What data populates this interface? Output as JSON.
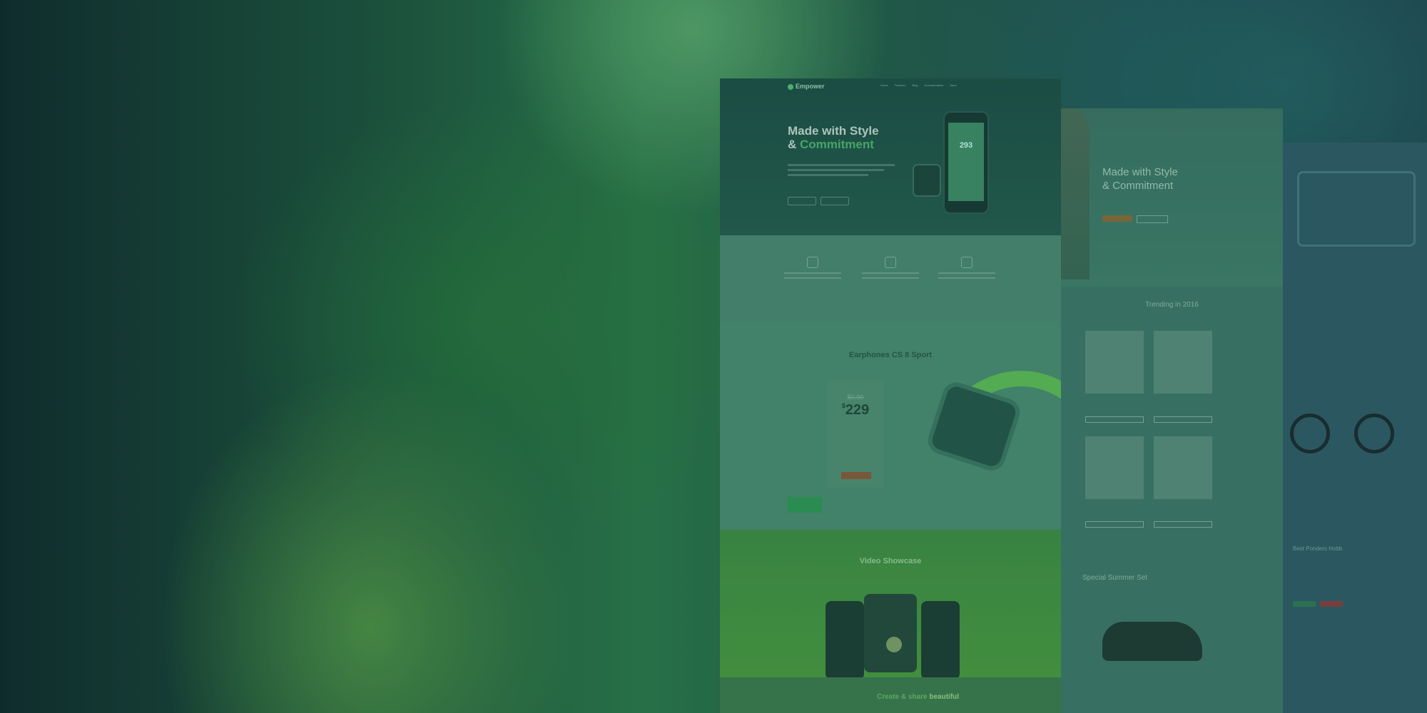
{
  "front_mockup": {
    "logo": "Empower",
    "nav": [
      "Home",
      "Features",
      "Blog",
      "Documentation",
      "Store",
      "",
      ""
    ],
    "hero": {
      "title_line1": "Made with Style",
      "title_amp": "& ",
      "title_accent": "Commitment",
      "phone_value": "293"
    },
    "pricing": {
      "title": "Earphones CS 8 Sport",
      "old_price": "$0.00",
      "price_currency": "$",
      "price_value": "229"
    },
    "video": {
      "title": "Video Showcase"
    },
    "create": {
      "title_part": "Create & share ",
      "title_accent": "beautiful"
    }
  },
  "second_mockup": {
    "hero_line1": "Made with Style",
    "hero_line2": "& Commitment",
    "section_title": "Trending in 2016",
    "summer_title": "Special Summer Set"
  },
  "third_mockup": {
    "promo_title": "Best Ponders Hobb"
  },
  "colors": {
    "accent_green": "#4fb870",
    "overlay": "#123c37"
  }
}
